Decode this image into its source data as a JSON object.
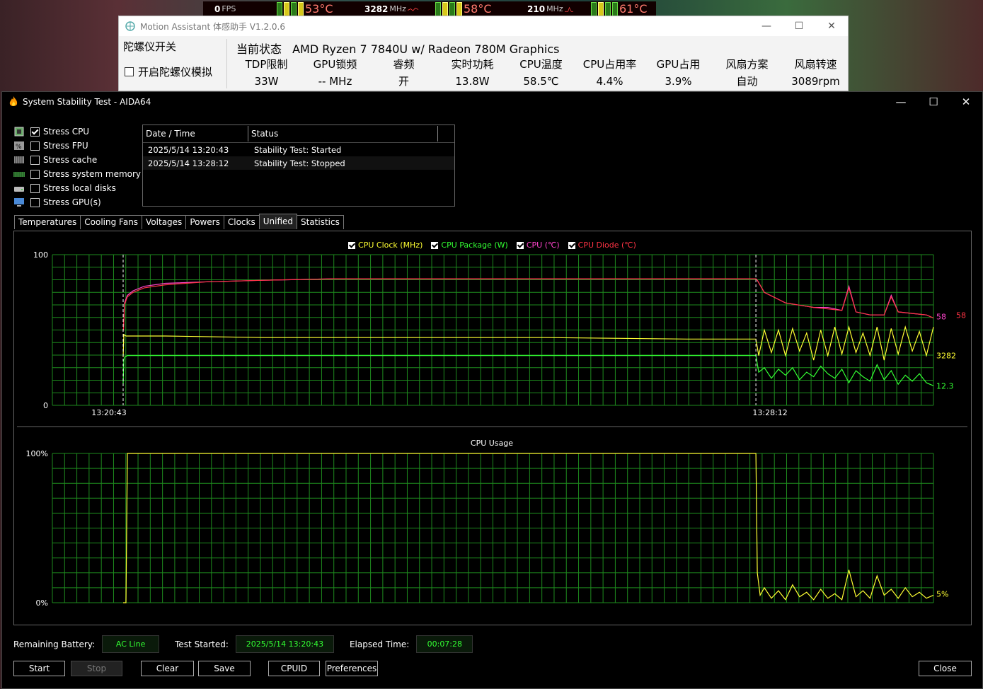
{
  "osd": {
    "fps": "0",
    "fps_unit": "FPS",
    "cpu_temp": "53°C",
    "cpu_clock": "3282",
    "cpu_clock_unit": "MHz",
    "gpu_temp": "58°C",
    "gpu_clock": "210",
    "gpu_clock_unit": "MHz",
    "other_temp": "61°C"
  },
  "motion_assistant": {
    "title": "Motion Assistant 体感助手 V1.2.0.6",
    "gyro_header": "陀螺仪开关",
    "gyro_option": "开启陀螺仪模拟",
    "status_label": "当前状态",
    "processor": "AMD Ryzen 7 7840U w/ Radeon 780M Graphics",
    "metrics": [
      {
        "label": "TDP限制",
        "value": "33W"
      },
      {
        "label": "GPU锁频",
        "value": "-- MHz"
      },
      {
        "label": "睿频",
        "value": "开"
      },
      {
        "label": "实时功耗",
        "value": "13.8W"
      },
      {
        "label": "CPU温度",
        "value": "58.5℃"
      },
      {
        "label": "CPU占用率",
        "value": "4.4%"
      },
      {
        "label": "GPU占用",
        "value": "3.9%"
      },
      {
        "label": "风扇方案",
        "value": "自动"
      },
      {
        "label": "风扇转速",
        "value": "3089rpm"
      }
    ]
  },
  "aida": {
    "title": "System Stability Test - AIDA64",
    "stress": [
      {
        "label": "Stress CPU",
        "checked": true
      },
      {
        "label": "Stress FPU",
        "checked": false
      },
      {
        "label": "Stress cache",
        "checked": false
      },
      {
        "label": "Stress system memory",
        "checked": false
      },
      {
        "label": "Stress local disks",
        "checked": false
      },
      {
        "label": "Stress GPU(s)",
        "checked": false
      }
    ],
    "log": {
      "col_date": "Date / Time",
      "col_status": "Status",
      "rows": [
        {
          "date": "2025/5/14 13:20:43",
          "status": "Stability Test: Started"
        },
        {
          "date": "2025/5/14 13:28:12",
          "status": "Stability Test: Stopped"
        }
      ]
    },
    "tabs": [
      "Temperatures",
      "Cooling Fans",
      "Voltages",
      "Powers",
      "Clocks",
      "Unified",
      "Statistics"
    ],
    "active_tab": "Unified",
    "bottom": {
      "battery_label": "Remaining Battery:",
      "battery_value": "AC Line",
      "started_label": "Test Started:",
      "started_value": "2025/5/14 13:20:43",
      "elapsed_label": "Elapsed Time:",
      "elapsed_value": "00:07:28"
    },
    "buttons": {
      "start": "Start",
      "stop": "Stop",
      "clear": "Clear",
      "save": "Save",
      "cpuid": "CPUID",
      "preferences": "Preferences",
      "close": "Close"
    }
  },
  "chart_data": [
    {
      "type": "line",
      "title": "",
      "legend": [
        "CPU Clock (MHz)",
        "CPU Package (W)",
        "CPU (℃)",
        "CPU Diode (℃)"
      ],
      "ylim": [
        0,
        100
      ],
      "ytick_labels": [
        "100",
        "0"
      ],
      "xtick_labels": [
        "13:20:43",
        "13:28:12"
      ],
      "end_labels": {
        "cpu_temp": "58",
        "cpu_diode": "58",
        "cpu_clock": "3282",
        "cpu_package": "12.3"
      },
      "series": [
        {
          "name": "CPU (℃)",
          "color": "#ff44cc",
          "x": [
            0,
            0.2,
            1,
            3,
            7,
            15,
            30,
            60,
            100,
            150,
            200,
            250,
            300,
            350,
            400,
            449,
            450,
            455,
            470,
            490,
            500,
            510,
            515,
            520,
            530,
            540,
            545,
            550,
            560,
            570,
            575
          ],
          "y": [
            50,
            50,
            68,
            73,
            76,
            79,
            81,
            82,
            83,
            84,
            84,
            84,
            84,
            84,
            84,
            84,
            83,
            75,
            68,
            65,
            65,
            63,
            79,
            62,
            60,
            60,
            73,
            62,
            61,
            60,
            58
          ]
        },
        {
          "name": "CPU Diode (℃)",
          "color": "#ff3344",
          "x": [
            0,
            0.2,
            1,
            3,
            7,
            15,
            30,
            60,
            100,
            150,
            200,
            250,
            300,
            350,
            400,
            449,
            450,
            455,
            470,
            490,
            500,
            510,
            515,
            520,
            530,
            540,
            545,
            550,
            560,
            570,
            575
          ],
          "y": [
            50,
            50,
            67,
            72,
            75,
            78,
            80,
            82,
            83,
            84,
            84,
            84,
            84,
            84,
            84,
            84,
            83,
            75,
            68,
            65,
            64,
            63,
            78,
            62,
            60,
            60,
            72,
            62,
            61,
            60,
            58
          ]
        },
        {
          "name": "CPU Clock (MHz)",
          "color": "#ffff33",
          "x": [
            0,
            0.5,
            2,
            30,
            100,
            200,
            300,
            400,
            449,
            451,
            455,
            460,
            465,
            470,
            475,
            480,
            485,
            490,
            495,
            500,
            505,
            510,
            515,
            520,
            525,
            530,
            535,
            540,
            545,
            550,
            555,
            560,
            565,
            570,
            575
          ],
          "y": [
            32,
            47,
            46,
            46,
            45,
            45,
            45,
            44,
            44,
            33,
            50,
            35,
            50,
            33,
            51,
            36,
            48,
            30,
            50,
            33,
            52,
            34,
            52,
            35,
            48,
            33,
            52,
            30,
            51,
            34,
            52,
            36,
            49,
            33,
            52
          ]
        },
        {
          "name": "CPU Package (W)",
          "color": "#33ff33",
          "x": [
            0,
            0.5,
            1,
            3,
            30,
            100,
            200,
            300,
            400,
            449,
            451,
            455,
            460,
            465,
            470,
            475,
            480,
            485,
            490,
            495,
            500,
            505,
            510,
            515,
            520,
            525,
            530,
            535,
            540,
            545,
            550,
            555,
            560,
            565,
            570,
            575
          ],
          "y": [
            14,
            30,
            32,
            33,
            33,
            33,
            33,
            33,
            33,
            33,
            22,
            25,
            18,
            24,
            20,
            25,
            17,
            22,
            19,
            26,
            21,
            18,
            24,
            15,
            23,
            19,
            16,
            27,
            17,
            23,
            14,
            20,
            16,
            21,
            15,
            13
          ]
        }
      ]
    },
    {
      "type": "line",
      "title": "CPU Usage",
      "ylim": [
        0,
        100
      ],
      "ytick_labels": [
        "100%",
        "0%"
      ],
      "end_labels": {
        "cpu_usage": "5%"
      },
      "series": [
        {
          "name": "CPU Usage",
          "color": "#ffff33",
          "x": [
            0,
            2,
            3,
            449,
            450,
            452,
            455,
            460,
            465,
            470,
            475,
            480,
            485,
            490,
            495,
            500,
            505,
            510,
            515,
            520,
            525,
            530,
            535,
            540,
            545,
            550,
            555,
            560,
            565,
            570,
            575
          ],
          "y": [
            0,
            0,
            100,
            100,
            20,
            5,
            10,
            3,
            8,
            2,
            12,
            4,
            7,
            2,
            9,
            3,
            6,
            2,
            22,
            4,
            8,
            3,
            18,
            5,
            9,
            3,
            10,
            4,
            7,
            3,
            5
          ]
        }
      ]
    }
  ]
}
